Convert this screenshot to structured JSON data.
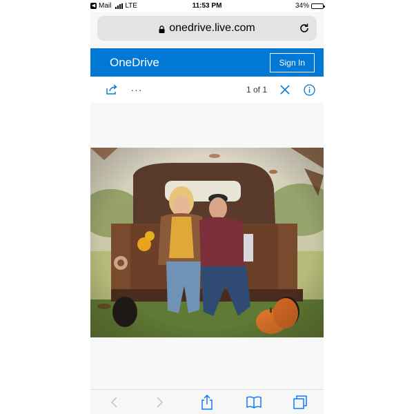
{
  "status_bar": {
    "back_app": "Mail",
    "network": "LTE",
    "time": "11:53 PM",
    "battery": "34%",
    "battery_level": 0.34
  },
  "browser": {
    "url": "onedrive.live.com",
    "icons": {
      "lock": "lock-icon",
      "reload": "reload-icon"
    }
  },
  "header": {
    "brand": "OneDrive",
    "sign_in_label": "Sign In",
    "accent": "#0078d4"
  },
  "toolbar": {
    "pager": "1 of 1",
    "more_glyph": "···",
    "icons": [
      "share-icon",
      "more-icon",
      "close-icon",
      "info-icon"
    ]
  },
  "viewer": {
    "photo": "photo of a couple seated on the tailgate of a rusty vintage pickup truck with pumpkins and autumn leaves"
  },
  "bottom_bar": {
    "icons": [
      "back-icon",
      "forward-icon",
      "share-icon",
      "bookmarks-icon",
      "tabs-icon"
    ],
    "disabled": [
      "back-icon",
      "forward-icon"
    ]
  }
}
